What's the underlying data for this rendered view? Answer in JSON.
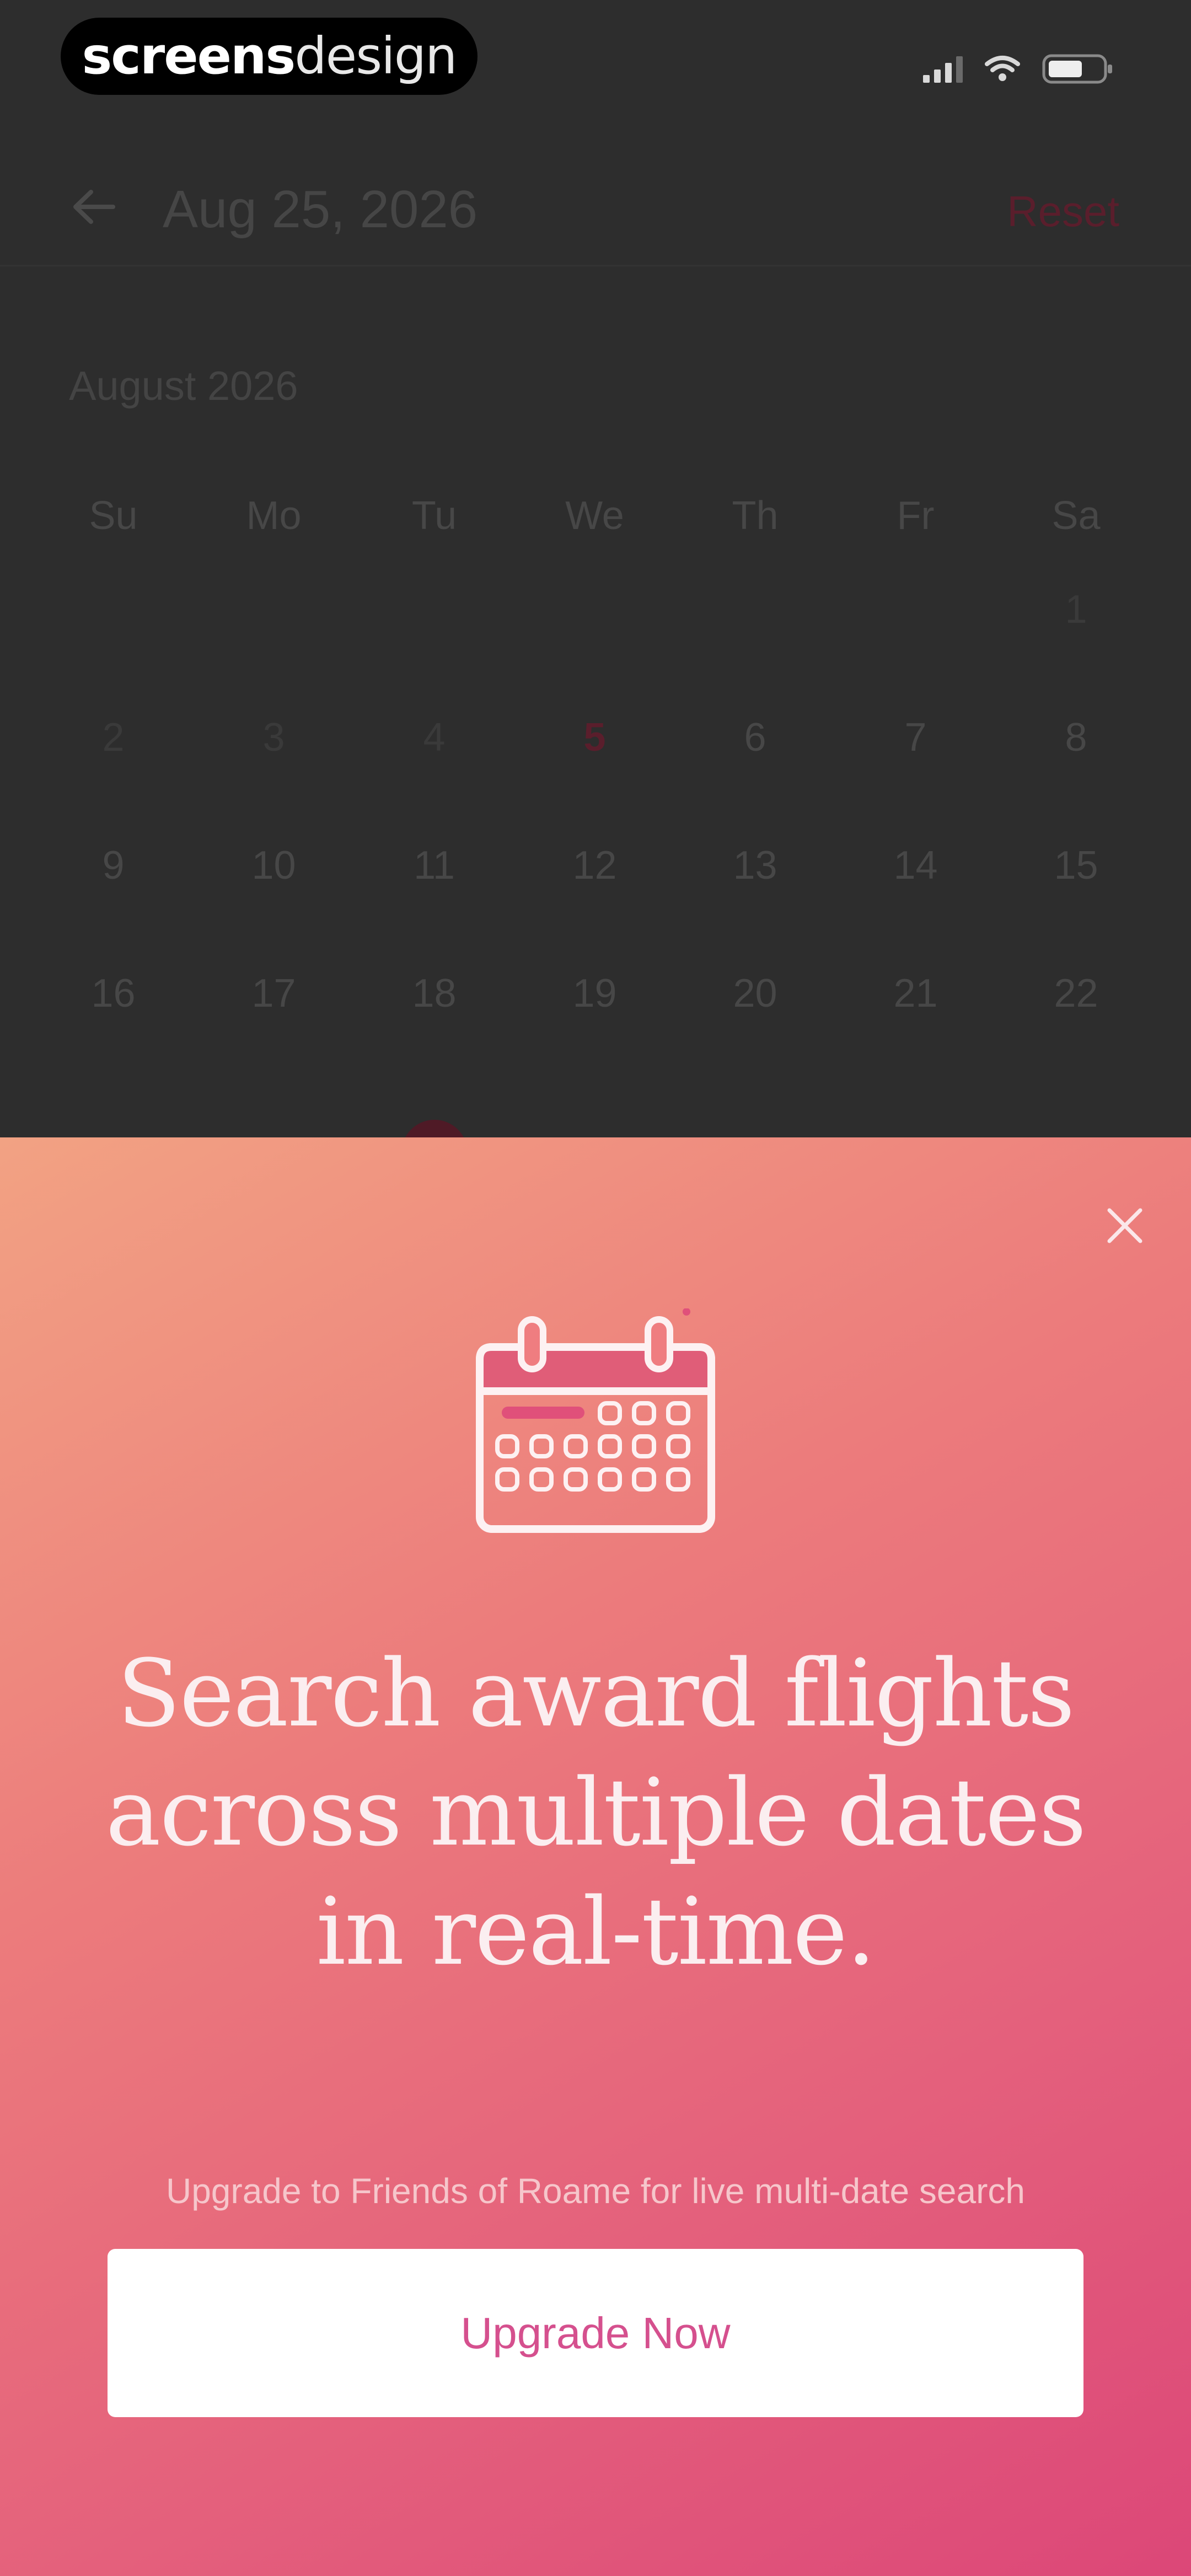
{
  "status_bar": {
    "watermark_bold": "screens",
    "watermark_light": "design",
    "icons": [
      "signal-icon",
      "wifi-icon",
      "battery-icon"
    ]
  },
  "nav": {
    "back_icon": "arrow-left-icon",
    "title": "Aug 25, 2026",
    "reset_label": "Reset"
  },
  "calendar": {
    "month_label": "August 2026",
    "weekdays": [
      "Su",
      "Mo",
      "Tu",
      "We",
      "Th",
      "Fr",
      "Sa"
    ],
    "weeks": [
      [
        "",
        "",
        "",
        "",
        "",
        "",
        "1"
      ],
      [
        "2",
        "3",
        "4",
        "5",
        "6",
        "7",
        "8"
      ],
      [
        "9",
        "10",
        "11",
        "12",
        "13",
        "14",
        "15"
      ],
      [
        "16",
        "17",
        "18",
        "19",
        "20",
        "21",
        "22"
      ]
    ],
    "highlighted_day": "5",
    "selected_day": "25"
  },
  "upsell": {
    "close_icon": "close-icon",
    "illustration_icon": "calendar-icon",
    "headline": "Search award flights across multiple dates in real-time.",
    "subtitle": "Upgrade to Friends of Roame for live multi-date search",
    "cta_label": "Upgrade Now"
  },
  "colors": {
    "background": "#2d2d2d",
    "accent_dark": "#5a1e2c",
    "gradient_start": "#f2a283",
    "gradient_end": "#dc4778",
    "cta_text": "#d5508e",
    "cta_background": "#ffffff"
  }
}
